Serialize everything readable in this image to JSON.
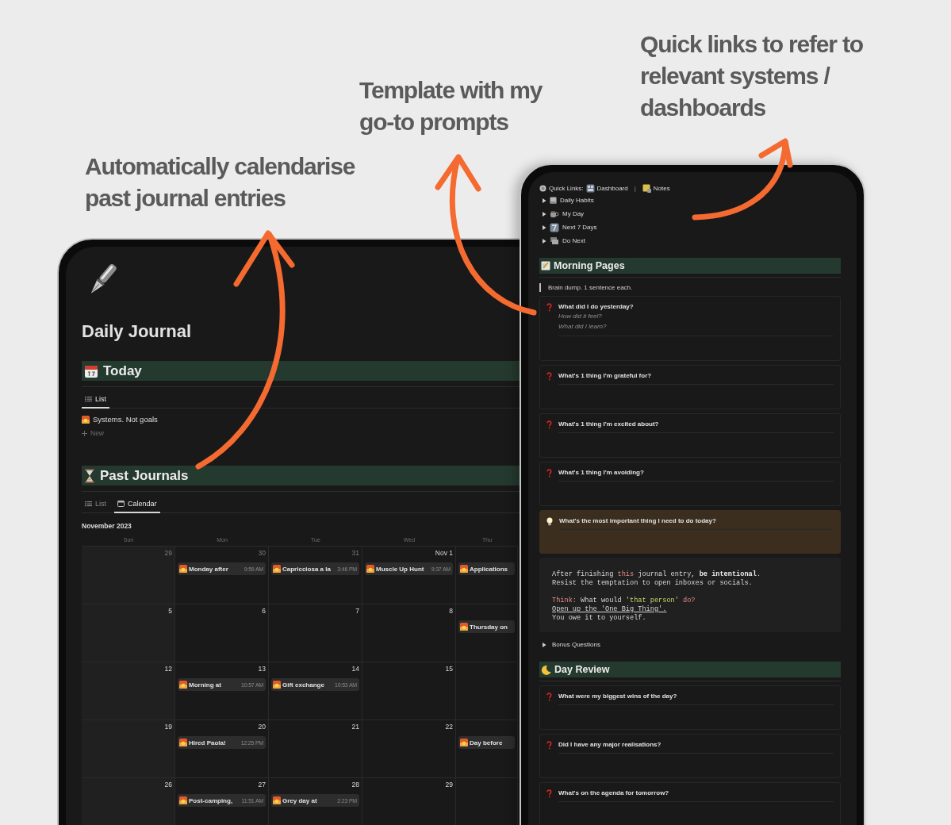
{
  "callouts": [
    {
      "text": "Automatically calendarise past journal entries"
    },
    {
      "text": "Template with my go-to prompts"
    },
    {
      "text": "Quick links to refer to relevant systems / dashboards"
    }
  ],
  "journal": {
    "title": "Daily Journal",
    "today": {
      "heading": "Today",
      "views": [
        {
          "label": "List",
          "selected": true
        }
      ],
      "items": [
        "Systems. Not goals"
      ],
      "new_label": "New"
    },
    "past": {
      "heading": "Past Journals",
      "views": [
        {
          "label": "List",
          "selected": false
        },
        {
          "label": "Calendar",
          "selected": true
        }
      ],
      "month": "November 2023",
      "weekdays": [
        "Sun",
        "Mon",
        "Tue",
        "Wed",
        "Thu"
      ],
      "weeks": [
        [
          {
            "day": "29",
            "muted": true
          },
          {
            "day": "30",
            "muted": true,
            "events": [
              {
                "title": "Monday after",
                "time": "9:59 AM"
              }
            ]
          },
          {
            "day": "31",
            "muted": true,
            "events": [
              {
                "title": "Capricciosa a la",
                "time": "3:46 PM"
              }
            ]
          },
          {
            "day": "Nov 1",
            "muted": false,
            "events": [
              {
                "title": "Muscle Up Hunt",
                "time": "9:37 AM"
              }
            ]
          },
          {
            "events": [
              {
                "title": "Applications"
              }
            ]
          }
        ],
        [
          {
            "day": "5",
            "muted": false
          },
          {
            "day": "6",
            "muted": false
          },
          {
            "day": "7",
            "muted": false
          },
          {
            "day": "8",
            "muted": false
          },
          {
            "events": [
              {
                "title": "Thursday on"
              }
            ]
          }
        ],
        [
          {
            "day": "12",
            "muted": false
          },
          {
            "day": "13",
            "muted": false,
            "events": [
              {
                "title": "Morning at",
                "time": "10:57 AM"
              }
            ]
          },
          {
            "day": "14",
            "muted": false,
            "events": [
              {
                "title": "Gift exchange",
                "time": "10:53 AM"
              }
            ]
          },
          {
            "day": "15",
            "muted": false
          }
        ],
        [
          {
            "day": "19",
            "muted": false
          },
          {
            "day": "20",
            "muted": false,
            "events": [
              {
                "title": "Hired Paola!",
                "time": "12:25 PM"
              }
            ]
          },
          {
            "day": "21",
            "muted": false
          },
          {
            "day": "22",
            "muted": false
          },
          {
            "events": [
              {
                "title": "Day before"
              }
            ]
          }
        ],
        [
          {
            "day": "26",
            "muted": false
          },
          {
            "day": "27",
            "muted": false,
            "events": [
              {
                "title": "Post-camping,",
                "time": "11:51 AM"
              }
            ]
          },
          {
            "day": "28",
            "muted": false,
            "events": [
              {
                "title": "Grey day at",
                "time": "2:23 PM"
              }
            ]
          },
          {
            "day": "29",
            "muted": false
          }
        ]
      ]
    }
  },
  "template": {
    "quick_links": {
      "label": "Quick Links:",
      "links": [
        "Dashboard",
        "Notes"
      ],
      "separator": "|"
    },
    "toggles": [
      {
        "label": "Daily Habits",
        "expanded": false
      },
      {
        "label": "My Day",
        "expanded": false
      },
      {
        "label": "Next 7 Days",
        "expanded": false
      },
      {
        "label": "Do Next",
        "expanded": false
      }
    ],
    "morning": {
      "heading": "Morning Pages",
      "quote": "Brain dump. 1 sentence each.",
      "prompts": [
        {
          "kind": "question",
          "text": "What did I do yesterday?",
          "hints": [
            "How did it feel?",
            "What did I learn?"
          ]
        },
        {
          "kind": "question",
          "text": "What's 1 thing I'm grateful for?"
        },
        {
          "kind": "question",
          "text": "What's 1 thing I'm excited about?"
        },
        {
          "kind": "question",
          "text": "What's 1 thing I'm avoiding?"
        },
        {
          "kind": "highlight",
          "text": "What's the most important thing I need to do today?"
        }
      ],
      "code_paragraphs": [
        [
          [
            {
              "kind": "plain",
              "text": "After finishing "
            },
            {
              "kind": "keyword",
              "text": "this"
            },
            {
              "kind": "plain",
              "text": " journal entry, "
            },
            {
              "kind": "bold",
              "text": "be intentional"
            },
            {
              "kind": "plain",
              "text": "."
            }
          ],
          [
            {
              "kind": "plain",
              "text": "Resist the temptation to open inboxes or socials."
            }
          ]
        ],
        [
          [
            {
              "kind": "keyword",
              "text": "Think:"
            },
            {
              "kind": "plain",
              "text": " What would "
            },
            {
              "kind": "string",
              "text": "'that person'"
            },
            {
              "kind": "keyword",
              "text": " do?"
            }
          ],
          [
            {
              "kind": "link",
              "text": "Open up the 'One Big Thing'."
            }
          ],
          [
            {
              "kind": "plain",
              "text": "You owe it to yourself."
            }
          ]
        ]
      ]
    },
    "bonus": {
      "label": "Bonus Questions",
      "expanded": false
    },
    "review": {
      "heading": "Day Review",
      "prompts": [
        {
          "kind": "question",
          "text": "What were my biggest wins of the day?"
        },
        {
          "kind": "question",
          "text": "Did I have any major realisations?"
        },
        {
          "kind": "question",
          "text": "What's on the agenda for tomorrow?"
        }
      ]
    }
  }
}
